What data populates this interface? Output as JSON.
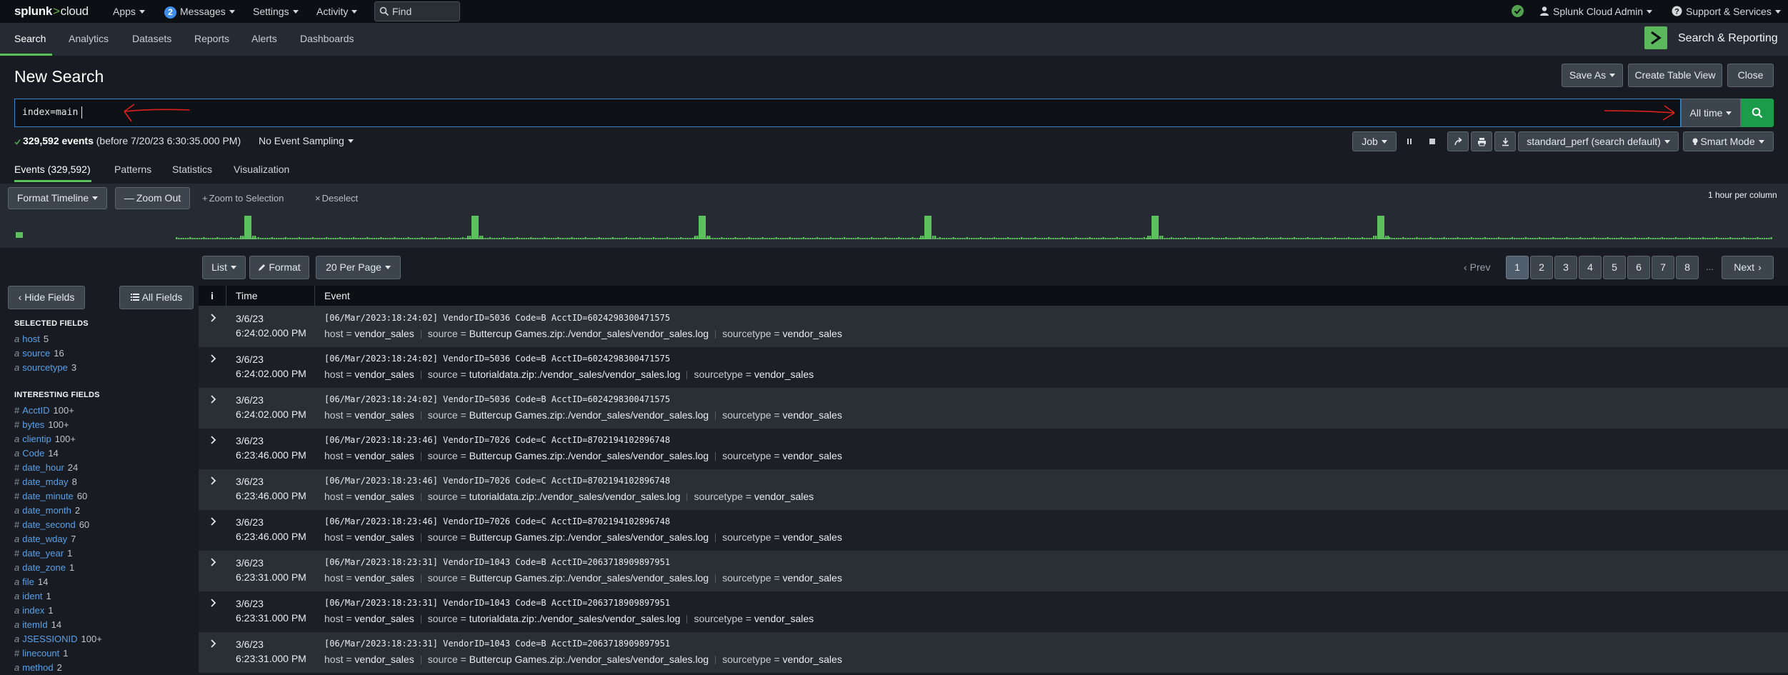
{
  "topbar": {
    "logo_main": "splunk",
    "logo_gt": ">",
    "logo_cloud": "cloud",
    "apps": "Apps",
    "messages_count": "2",
    "messages": "Messages",
    "settings": "Settings",
    "activity": "Activity",
    "find_placeholder": "Find",
    "user": "Splunk Cloud Admin",
    "support": "Support & Services",
    "status_color": "#53a051"
  },
  "appbar": {
    "tabs": [
      "Search",
      "Analytics",
      "Datasets",
      "Reports",
      "Alerts",
      "Dashboards"
    ],
    "app_name": "Search & Reporting",
    "accent": "#5cc05c"
  },
  "header": {
    "title": "New Search",
    "save_as": "Save As",
    "create_table_view": "Create Table View",
    "close": "Close"
  },
  "search": {
    "query": "index=main",
    "time_range": "All time"
  },
  "status": {
    "events": "329,592 events",
    "before": "(before 7/20/23 6:30:35.000 PM)",
    "sampling": "No Event Sampling",
    "job": "Job",
    "perf": "standard_perf (search default)",
    "mode": "Smart Mode"
  },
  "result_tabs": [
    "Events (329,592)",
    "Patterns",
    "Statistics",
    "Visualization"
  ],
  "timeline": {
    "format_timeline": "Format Timeline",
    "zoom_out": "Zoom Out",
    "zoom_to_selection": "Zoom to Selection",
    "deselect": "Deselect",
    "scale": "1 hour per column"
  },
  "list_controls": {
    "list": "List",
    "format": "Format",
    "per_page": "20 Per Page"
  },
  "pagination": {
    "prev": "Prev",
    "pages": [
      "1",
      "2",
      "3",
      "4",
      "5",
      "6",
      "7",
      "8"
    ],
    "ellipsis": "...",
    "next": "Next",
    "current": "1"
  },
  "fields_panel": {
    "hide_fields": "Hide Fields",
    "all_fields": "All Fields",
    "selected_heading": "SELECTED FIELDS",
    "interesting_heading": "INTERESTING FIELDS",
    "selected": [
      {
        "type": "a",
        "name": "host",
        "count": "5"
      },
      {
        "type": "a",
        "name": "source",
        "count": "16"
      },
      {
        "type": "a",
        "name": "sourcetype",
        "count": "3"
      }
    ],
    "interesting": [
      {
        "type": "#",
        "name": "AcctID",
        "count": "100+"
      },
      {
        "type": "#",
        "name": "bytes",
        "count": "100+"
      },
      {
        "type": "a",
        "name": "clientip",
        "count": "100+"
      },
      {
        "type": "a",
        "name": "Code",
        "count": "14"
      },
      {
        "type": "#",
        "name": "date_hour",
        "count": "24"
      },
      {
        "type": "#",
        "name": "date_mday",
        "count": "8"
      },
      {
        "type": "#",
        "name": "date_minute",
        "count": "60"
      },
      {
        "type": "a",
        "name": "date_month",
        "count": "2"
      },
      {
        "type": "#",
        "name": "date_second",
        "count": "60"
      },
      {
        "type": "a",
        "name": "date_wday",
        "count": "7"
      },
      {
        "type": "#",
        "name": "date_year",
        "count": "1"
      },
      {
        "type": "a",
        "name": "date_zone",
        "count": "1"
      },
      {
        "type": "a",
        "name": "file",
        "count": "14"
      },
      {
        "type": "a",
        "name": "ident",
        "count": "1"
      },
      {
        "type": "a",
        "name": "index",
        "count": "1"
      },
      {
        "type": "a",
        "name": "itemId",
        "count": "14"
      },
      {
        "type": "a",
        "name": "JSESSIONID",
        "count": "100+"
      },
      {
        "type": "#",
        "name": "linecount",
        "count": "1"
      },
      {
        "type": "a",
        "name": "method",
        "count": "2"
      }
    ]
  },
  "table": {
    "col_info": "i",
    "col_time": "Time",
    "col_event": "Event",
    "host_key": "host =",
    "source_key": "source =",
    "sourcetype_key": "sourcetype =",
    "rows": [
      {
        "date": "3/6/23",
        "time": "6:24:02.000 PM",
        "raw": "[06/Mar/2023:18:24:02] VendorID=5036 Code=B AcctID=6024298300471575",
        "host": "vendor_sales",
        "source": "Buttercup Games.zip:./vendor_sales/vendor_sales.log",
        "sourcetype": "vendor_sales"
      },
      {
        "date": "3/6/23",
        "time": "6:24:02.000 PM",
        "raw": "[06/Mar/2023:18:24:02] VendorID=5036 Code=B AcctID=6024298300471575",
        "host": "vendor_sales",
        "source": "tutorialdata.zip:./vendor_sales/vendor_sales.log",
        "sourcetype": "vendor_sales"
      },
      {
        "date": "3/6/23",
        "time": "6:24:02.000 PM",
        "raw": "[06/Mar/2023:18:24:02] VendorID=5036 Code=B AcctID=6024298300471575",
        "host": "vendor_sales",
        "source": "Buttercup Games.zip:./vendor_sales/vendor_sales.log",
        "sourcetype": "vendor_sales"
      },
      {
        "date": "3/6/23",
        "time": "6:23:46.000 PM",
        "raw": "[06/Mar/2023:18:23:46] VendorID=7026 Code=C AcctID=8702194102896748",
        "host": "vendor_sales",
        "source": "Buttercup Games.zip:./vendor_sales/vendor_sales.log",
        "sourcetype": "vendor_sales"
      },
      {
        "date": "3/6/23",
        "time": "6:23:46.000 PM",
        "raw": "[06/Mar/2023:18:23:46] VendorID=7026 Code=C AcctID=8702194102896748",
        "host": "vendor_sales",
        "source": "tutorialdata.zip:./vendor_sales/vendor_sales.log",
        "sourcetype": "vendor_sales"
      },
      {
        "date": "3/6/23",
        "time": "6:23:46.000 PM",
        "raw": "[06/Mar/2023:18:23:46] VendorID=7026 Code=C AcctID=8702194102896748",
        "host": "vendor_sales",
        "source": "Buttercup Games.zip:./vendor_sales/vendor_sales.log",
        "sourcetype": "vendor_sales"
      },
      {
        "date": "3/6/23",
        "time": "6:23:31.000 PM",
        "raw": "[06/Mar/2023:18:23:31] VendorID=1043 Code=B AcctID=2063718909897951",
        "host": "vendor_sales",
        "source": "Buttercup Games.zip:./vendor_sales/vendor_sales.log",
        "sourcetype": "vendor_sales"
      },
      {
        "date": "3/6/23",
        "time": "6:23:31.000 PM",
        "raw": "[06/Mar/2023:18:23:31] VendorID=1043 Code=B AcctID=2063718909897951",
        "host": "vendor_sales",
        "source": "tutorialdata.zip:./vendor_sales/vendor_sales.log",
        "sourcetype": "vendor_sales"
      },
      {
        "date": "3/6/23",
        "time": "6:23:31.000 PM",
        "raw": "[06/Mar/2023:18:23:31] VendorID=1043 Code=B AcctID=2063718909897951",
        "host": "vendor_sales",
        "source": "Buttercup Games.zip:./vendor_sales/vendor_sales.log",
        "sourcetype": "vendor_sales"
      }
    ]
  },
  "colors": {
    "accent_green": "#5cc05c",
    "go_green": "#1a9c4b",
    "link_blue": "#5aa0e8",
    "annotation_red": "#e0201c"
  }
}
